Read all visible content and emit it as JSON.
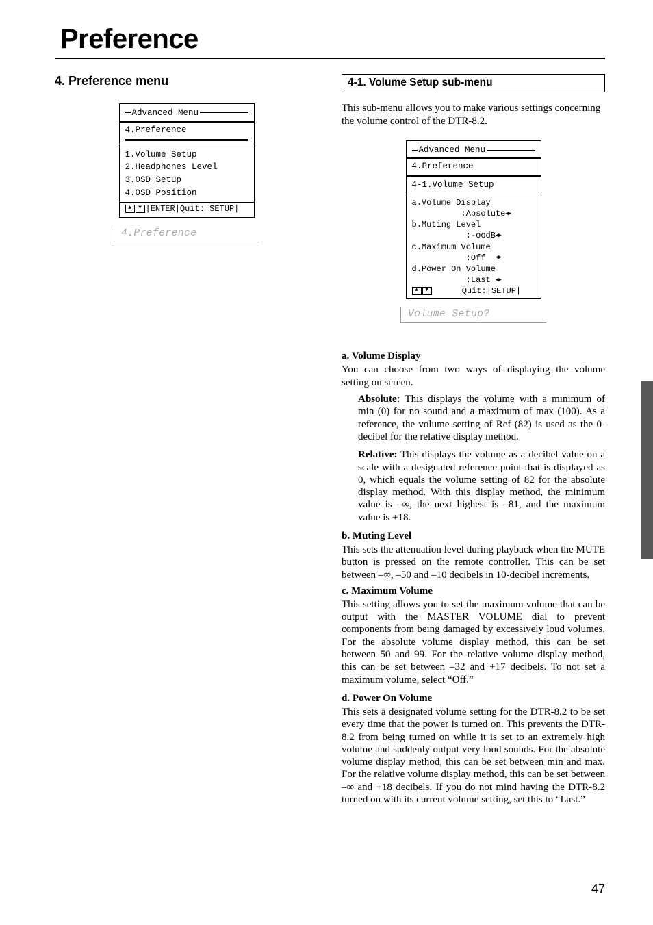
{
  "page": {
    "main_title": "Preference",
    "page_number": "47",
    "left": {
      "heading": "4. Preference menu",
      "osd": {
        "top_label": "Advanced Menu",
        "title": "4.Preference",
        "items": [
          "1.Volume Setup",
          "2.Headphones Level",
          "3.OSD Setup",
          "4.OSD Position"
        ],
        "footer": "|ENTER|Quit:|SETUP|"
      },
      "segment": "4.Preference"
    },
    "right": {
      "heading": "4-1. Volume Setup sub-menu",
      "intro": "This sub-menu allows you to make various settings concerning the volume control of the DTR-8.2.",
      "osd": {
        "top_label": "Advanced Menu",
        "title": "4.Preference",
        "sub": "4-1.Volume Setup",
        "rows": [
          "a.Volume Display",
          "          :Absolute",
          "b.Muting Level",
          "           :-oodB",
          "c.Maximum Volume",
          "           :Off  ",
          "d.Power On Volume",
          "           :Last "
        ],
        "footer": "      Quit:|SETUP|"
      },
      "segment": "Volume Setup?",
      "sections": {
        "a": {
          "heading": "a. Volume Display",
          "intro": "You can choose from two ways of displaying the volume setting on screen.",
          "abs_label": "Absolute:",
          "abs_text": " This displays the volume with a minimum of min (0) for no sound and a maximum of max (100). As a reference, the volume setting of Ref (82) is used as the 0-decibel for the relative display method.",
          "rel_label": "Relative:",
          "rel_text": " This displays the volume as a decibel value on a scale with a designated reference point that is displayed as 0, which equals the volume setting of 82 for the absolute display method. With this display method, the minimum value is –∞, the next highest is –81, and the maximum value is +18."
        },
        "b": {
          "heading": "b. Muting Level",
          "text": "This sets the attenuation level during playback when the MUTE button is pressed on the remote controller. This can be set between –∞, –50 and –10 decibels in 10-decibel increments."
        },
        "c": {
          "heading": "c. Maximum Volume",
          "text": "This setting allows you to set the maximum volume that can be output with the MASTER VOLUME dial to prevent components from being damaged by excessively loud volumes. For the absolute volume display method, this can be set between 50 and 99. For the relative volume display method, this can be set between –32 and +17 decibels. To not set a maximum volume, select “Off.”"
        },
        "d": {
          "heading": "d. Power On Volume",
          "text": "This sets a designated volume setting for the DTR-8.2 to be set every time that the power is turned on. This prevents the DTR-8.2 from being turned on while it is set to an extremely high volume and suddenly output very loud sounds. For the absolute volume display method, this can be set between min and max. For the relative volume display method, this can be set between –∞ and +18 decibels. If you do not mind having the DTR-8.2 turned on with its current volume setting, set this to “Last.”"
        }
      }
    }
  }
}
